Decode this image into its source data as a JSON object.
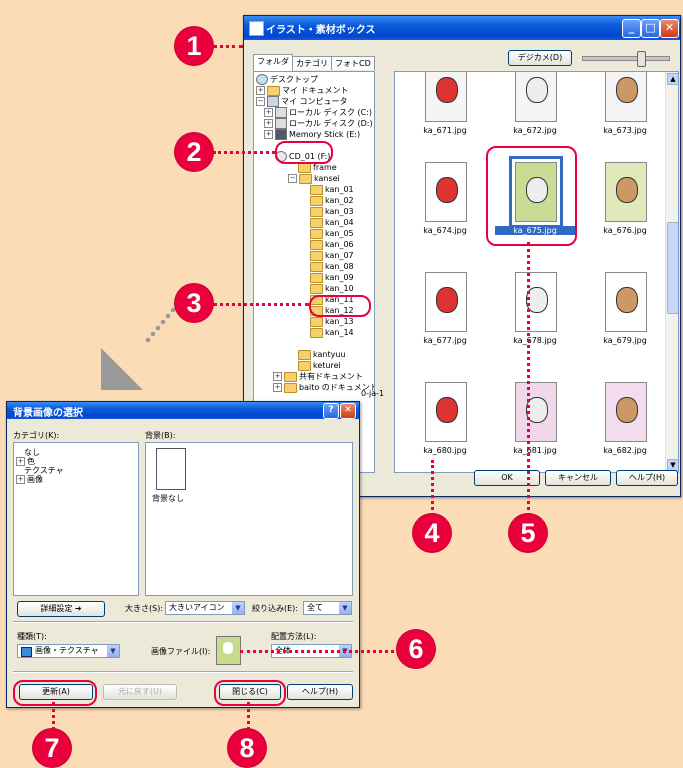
{
  "window": {
    "title": "イラスト・素材ボックス",
    "tabs": [
      "フォルダ",
      "カテゴリ",
      "フォトCD"
    ],
    "camera_button": "デジカメ(D)",
    "tree": [
      {
        "label": "デスクトップ",
        "icon": "desktop-icon"
      },
      {
        "label": "マイ ドキュメント",
        "icon": "folder-icon"
      },
      {
        "label": "マイ コンピュータ",
        "icon": "computer-icon"
      },
      {
        "label": "ローカル ディスク (C:)",
        "icon": "disk-icon"
      },
      {
        "label": "ローカル ディスク (D:)",
        "icon": "disk-icon"
      },
      {
        "label": "Memory Stick (E:)",
        "icon": "memory-stick-icon"
      },
      {
        "label": "CD_01 (F:)",
        "icon": "cd-icon"
      },
      {
        "label": "frame",
        "icon": "folder-icon"
      },
      {
        "label": "kansei",
        "icon": "folder-icon"
      },
      {
        "label": "kan_01",
        "icon": "folder-icon"
      },
      {
        "label": "kan_02",
        "icon": "folder-icon"
      },
      {
        "label": "kan_03",
        "icon": "folder-icon"
      },
      {
        "label": "kan_04",
        "icon": "folder-icon"
      },
      {
        "label": "kan_05",
        "icon": "folder-icon"
      },
      {
        "label": "kan_06",
        "icon": "folder-icon"
      },
      {
        "label": "kan_07",
        "icon": "folder-icon"
      },
      {
        "label": "kan_08",
        "icon": "folder-icon"
      },
      {
        "label": "kan_09",
        "icon": "folder-icon"
      },
      {
        "label": "kan_10",
        "icon": "folder-icon"
      },
      {
        "label": "kan_11",
        "icon": "folder-icon"
      },
      {
        "label": "kan_12",
        "icon": "folder-icon"
      },
      {
        "label": "kan_13",
        "icon": "folder-icon"
      },
      {
        "label": "kan_14",
        "icon": "folder-icon"
      },
      {
        "label": "kantyuu",
        "icon": "folder-icon"
      },
      {
        "label": "keturei",
        "icon": "folder-icon"
      },
      {
        "label": "共有ドキュメント",
        "icon": "folder-icon"
      },
      {
        "label": "baito のドキュメント",
        "icon": "folder-icon"
      }
    ],
    "partial_tree_label": "0-ja-1",
    "thumbnails": [
      {
        "label": "ka_671.jpg"
      },
      {
        "label": "ka_672.jpg"
      },
      {
        "label": "ka_673.jpg"
      },
      {
        "label": "ka_674.jpg"
      },
      {
        "label": "ka_675.jpg"
      },
      {
        "label": "ka_676.jpg"
      },
      {
        "label": "ka_677.jpg"
      },
      {
        "label": "ka_678.jpg"
      },
      {
        "label": "ka_679.jpg"
      },
      {
        "label": "ka_680.jpg"
      },
      {
        "label": "ka_681.jpg"
      },
      {
        "label": "ka_682.jpg"
      }
    ],
    "selected_thumbnail": "ka_675.jpg",
    "buttons": {
      "ok": "OK",
      "cancel": "キャンセル",
      "help": "ヘルプ(H)"
    }
  },
  "dialog": {
    "title": "背景画像の選択",
    "category_label": "カテゴリ(K):",
    "categories": [
      "なし",
      "色",
      "テクスチャ",
      "画像"
    ],
    "background_label": "背景(B):",
    "background_item": "背景なし",
    "detail_button": "詳細設定",
    "size_label": "大きさ(S):",
    "size_value": "大きいアイコン",
    "filter_label": "絞り込み(E):",
    "filter_value": "全て",
    "type_label": "種類(T):",
    "type_value": "画像・テクスチャ",
    "image_file_label": "画像ファイル(I):",
    "layout_label": "配置方法(L):",
    "layout_value": "全体",
    "buttons": {
      "update": "更新(A)",
      "undo": "元に戻す(U)",
      "close": "閉じる(C)",
      "help": "ヘルプ(H)"
    }
  },
  "annotations": [
    "1",
    "2",
    "3",
    "4",
    "5",
    "6",
    "7",
    "8"
  ],
  "colors": {
    "accent": "#e9003c",
    "background": "#fbdcb6",
    "titlebar": "#0a5ad8"
  }
}
